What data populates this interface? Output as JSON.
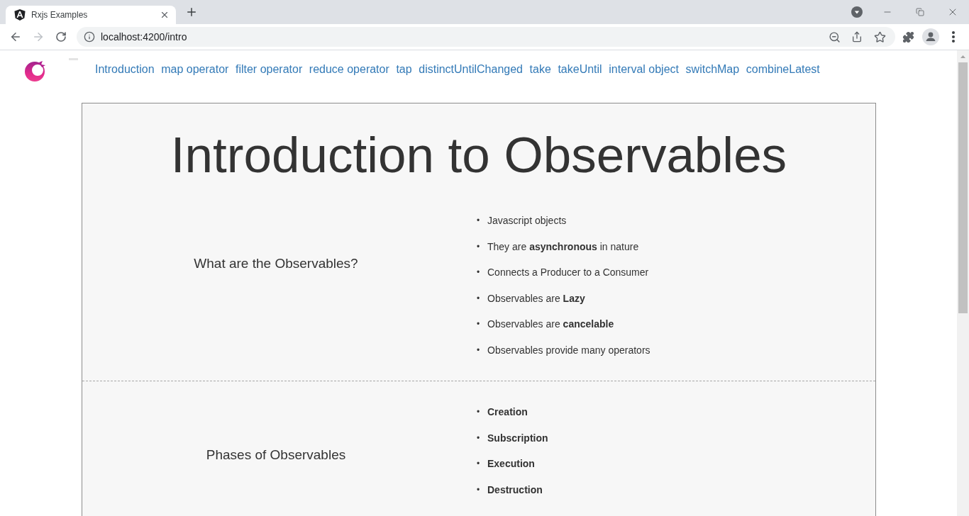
{
  "browser": {
    "tab": {
      "title": "Rxjs Examples",
      "selected": true
    },
    "forward": {
      "disabled": true
    },
    "address_bar": {
      "url": "localhost:4200/intro"
    }
  },
  "nav": {
    "links": [
      "Introduction",
      "map operator",
      "filter operator",
      "reduce operator",
      "tap",
      "distinctUntilChanged",
      "take",
      "takeUntil",
      "interval object",
      "switchMap",
      "combineLatest"
    ]
  },
  "page": {
    "title": "Introduction to Observables",
    "sections": [
      {
        "heading": "What are the Observables?",
        "kind": "plain",
        "bullet": "•",
        "items": [
          "Javascript objects",
          "They are **asynchronous** in nature",
          "Connects a Producer to a Consumer",
          "Observables are **Lazy**",
          "Observables are **cancelable**",
          "Observables provide many operators"
        ]
      },
      {
        "heading": "Phases of Observables",
        "kind": "emphasized",
        "bullet": "•",
        "items": [
          "Creation",
          "Subscription",
          "Execution",
          "Destruction"
        ]
      }
    ]
  }
}
